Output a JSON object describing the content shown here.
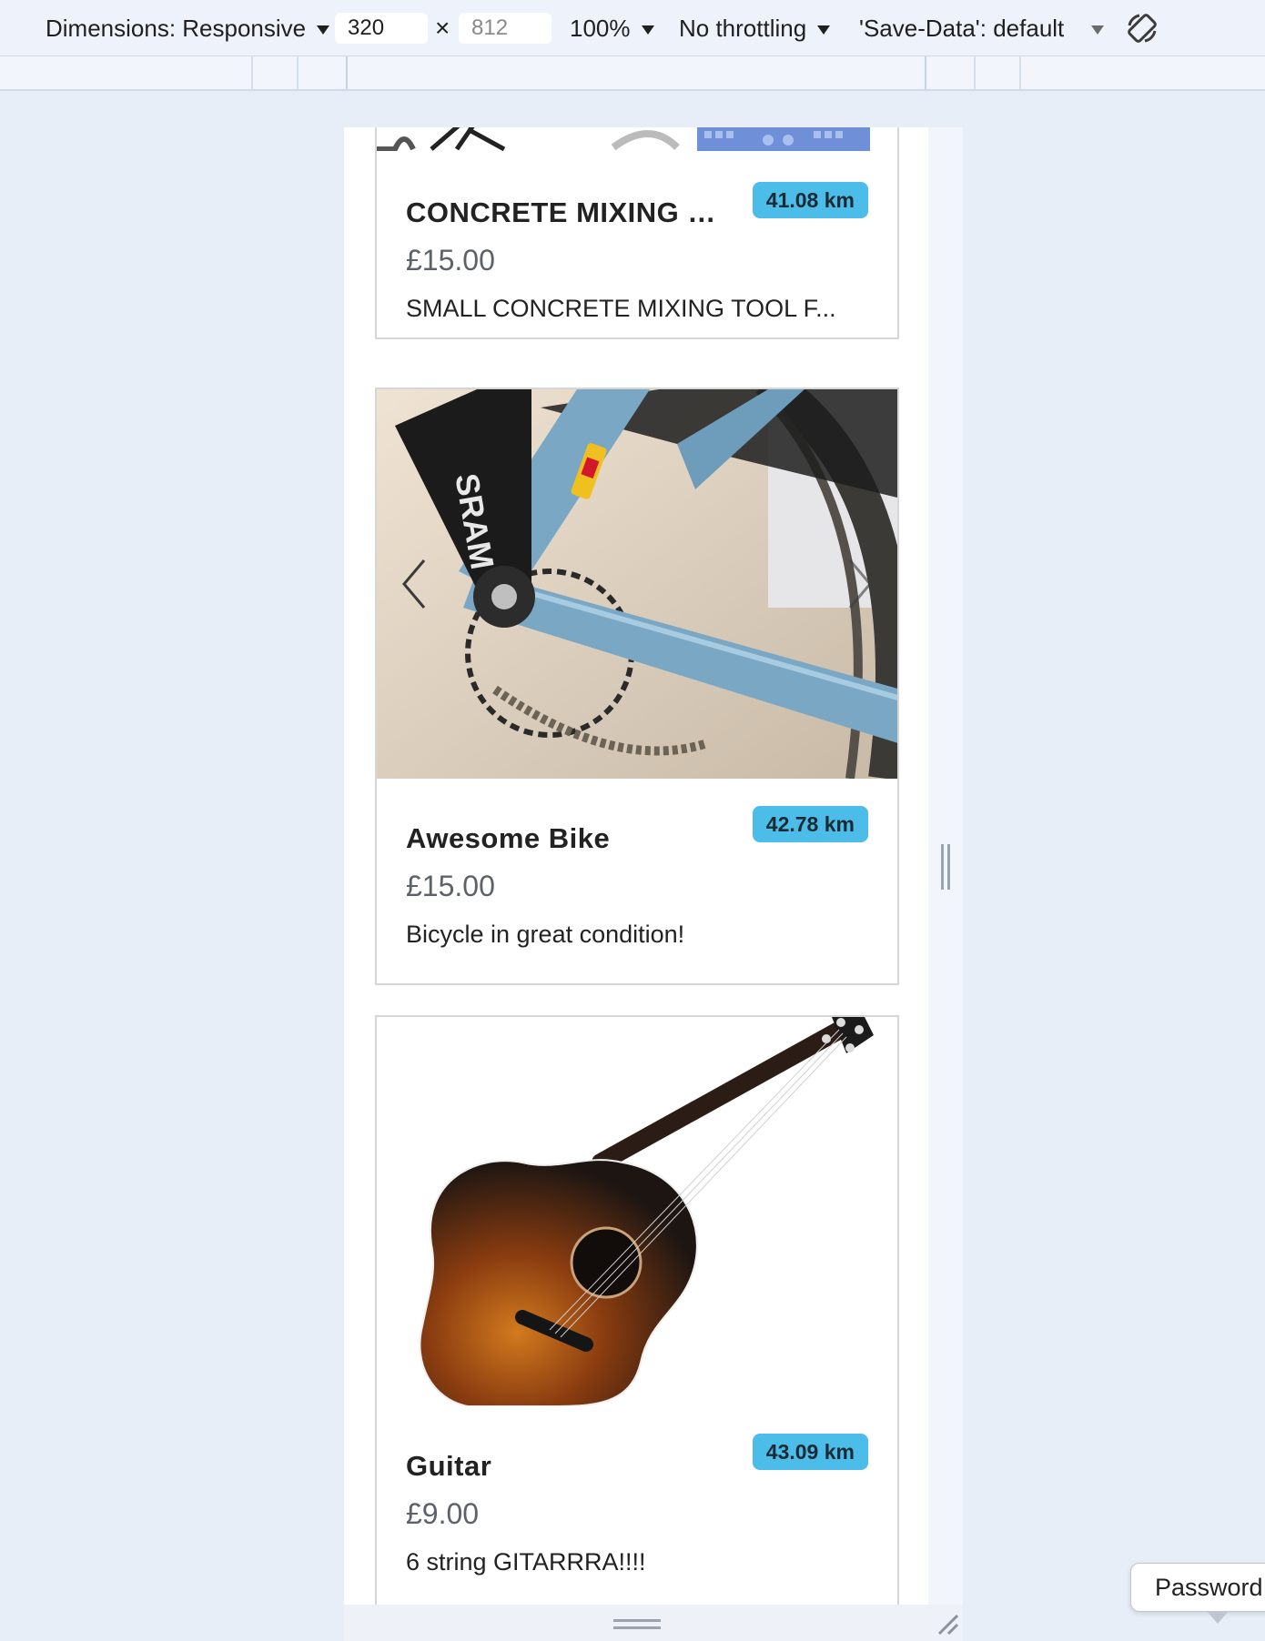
{
  "devtools": {
    "dimensions_label": "Dimensions: Responsive",
    "width_value": "320",
    "times_symbol": "×",
    "height_placeholder": "812",
    "zoom": "100%",
    "throttling": "No throttling",
    "save_data": "'Save-Data': default"
  },
  "listings": [
    {
      "title": "CONCRETE MIXING …",
      "distance": "41.08 km",
      "price": "£15.00",
      "description": "SMALL CONCRETE MIXING TOOL F..."
    },
    {
      "title": "Awesome Bike",
      "distance": "42.78 km",
      "price": "£15.00",
      "description": "Bicycle in great condition!"
    },
    {
      "title": "Guitar",
      "distance": "43.09 km",
      "price": "£9.00",
      "description": "6 string GITARRRA!!!!"
    }
  ],
  "tooltip": {
    "label": "Password"
  }
}
